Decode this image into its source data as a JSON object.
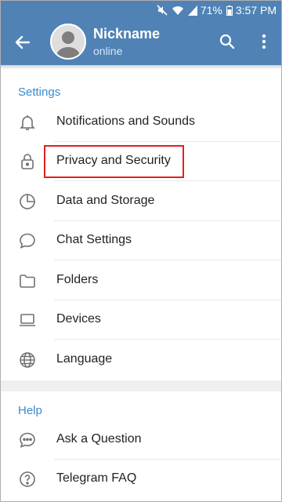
{
  "status_bar": {
    "battery": "71%",
    "time": "3:57 PM",
    "icons": [
      "mute-icon",
      "wifi-icon",
      "signal-icon",
      "battery-icon"
    ]
  },
  "header": {
    "title": "Nickname",
    "subtitle": "online",
    "back_icon": "arrow-left-icon",
    "search_icon": "search-icon",
    "more_icon": "more-vertical-icon",
    "background": "#5082b5"
  },
  "settings": {
    "section_title": "Settings",
    "items": [
      {
        "label": "Notifications and Sounds",
        "icon": "bell-icon"
      },
      {
        "label": "Privacy and Security",
        "icon": "lock-icon",
        "highlighted": true
      },
      {
        "label": "Data and Storage",
        "icon": "pie-chart-icon"
      },
      {
        "label": "Chat Settings",
        "icon": "chat-bubble-icon"
      },
      {
        "label": "Folders",
        "icon": "folder-icon"
      },
      {
        "label": "Devices",
        "icon": "laptop-icon"
      },
      {
        "label": "Language",
        "icon": "globe-icon"
      }
    ]
  },
  "help": {
    "section_title": "Help",
    "items": [
      {
        "label": "Ask a Question",
        "icon": "chat-dots-icon"
      },
      {
        "label": "Telegram FAQ",
        "icon": "question-circle-icon"
      }
    ]
  },
  "colors": {
    "accent": "#3a8ccf",
    "highlight_border": "#e02020"
  }
}
